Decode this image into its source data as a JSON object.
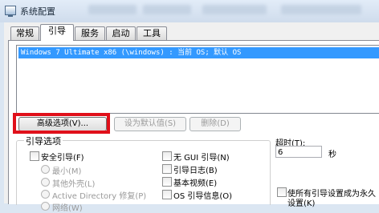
{
  "window": {
    "title": "系统配置"
  },
  "tabs": [
    {
      "label": "常规",
      "active": false
    },
    {
      "label": "引导",
      "active": true
    },
    {
      "label": "服务",
      "active": false
    },
    {
      "label": "启动",
      "active": false
    },
    {
      "label": "工具",
      "active": false
    }
  ],
  "os_list": {
    "items": [
      "Windows 7 Ultimate x86 (\\windows) : 当前 OS; 默认 OS"
    ]
  },
  "buttons": {
    "advanced": "高级选项(V)...",
    "set_default": "设为默认值(S)",
    "delete": "删除(D)"
  },
  "boot_options": {
    "title": "引导选项",
    "safe_boot": "安全引导(F)",
    "minimal": "最小(M)",
    "alternate_shell": "其他外壳(L)",
    "active_directory": "Active Directory 修复(P)",
    "network": "网络(W)",
    "no_gui": "无 GUI 引导(N)",
    "boot_log": "引导日志(B)",
    "base_video": "基本视频(E)",
    "os_info": "OS 引导信息(O)"
  },
  "timeout": {
    "label": "超时(T):",
    "value": "6",
    "unit": "秒"
  },
  "permanent": {
    "line1": "使所有引导设置成为永久",
    "line2": "设置(K)"
  },
  "colors": {
    "selection": "#3399ff",
    "highlight_box": "#e0101a"
  }
}
